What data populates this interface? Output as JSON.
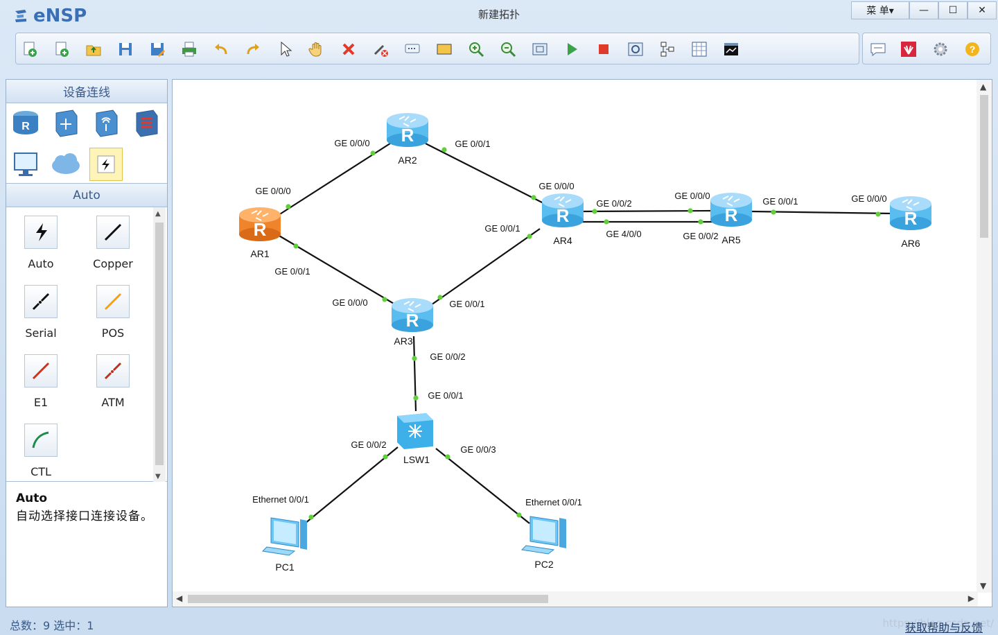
{
  "app": {
    "name": "eNSP",
    "title": "新建拓扑"
  },
  "window_controls": {
    "menu": "菜 单▾",
    "minimize": "—",
    "maximize": "☐",
    "close": "✕"
  },
  "toolbar": {
    "main": [
      "new-topology-icon",
      "new-example-icon",
      "open-icon",
      "save-icon",
      "save-as-icon",
      "print-icon",
      "undo-icon",
      "redo-icon",
      "select-icon",
      "pan-hand-icon",
      "delete-icon",
      "delete-link-icon",
      "text-label-icon",
      "rectangle-icon",
      "zoom-in-icon",
      "zoom-out-icon",
      "fit-view-icon",
      "start-devices-icon",
      "stop-devices-icon",
      "capture-icon",
      "topology-view-icon",
      "grid-icon",
      "console-icon"
    ],
    "right": [
      "chat-icon",
      "huawei-icon",
      "settings-icon",
      "help-icon"
    ]
  },
  "left_panel": {
    "header": "设备连线",
    "devices": [
      "router-icon",
      "switch-icon",
      "wireless-icon",
      "firewall-icon",
      "pc-icon",
      "cloud-icon",
      "connection-icon"
    ],
    "cable_header": "Auto",
    "cables": [
      {
        "label": "Auto",
        "icon": "auto-cable-icon",
        "color": "#111111"
      },
      {
        "label": "Copper",
        "icon": "copper-cable-icon",
        "color": "#111111"
      },
      {
        "label": "Serial",
        "icon": "serial-cable-icon",
        "color": "#111111"
      },
      {
        "label": "POS",
        "icon": "pos-cable-icon",
        "color": "#f5a01c"
      },
      {
        "label": "E1",
        "icon": "e1-cable-icon",
        "color": "#c8321e"
      },
      {
        "label": "ATM",
        "icon": "atm-cable-icon",
        "color": "#b8321e"
      },
      {
        "label": "CTL",
        "icon": "ctl-cable-icon",
        "color": "#1e8c4a"
      }
    ],
    "desc_title": "Auto",
    "desc_text": "自动选择接口连接设备。"
  },
  "topology": {
    "nodes": [
      {
        "id": "AR1",
        "label": "AR1",
        "type": "router",
        "color": "orange"
      },
      {
        "id": "AR2",
        "label": "AR2",
        "type": "router",
        "color": "blue"
      },
      {
        "id": "AR3",
        "label": "AR3",
        "type": "router",
        "color": "blue"
      },
      {
        "id": "AR4",
        "label": "AR4",
        "type": "router",
        "color": "blue"
      },
      {
        "id": "AR5",
        "label": "AR5",
        "type": "router",
        "color": "blue"
      },
      {
        "id": "AR6",
        "label": "AR6",
        "type": "router",
        "color": "blue"
      },
      {
        "id": "LSW1",
        "label": "LSW1",
        "type": "switch",
        "color": "blue"
      },
      {
        "id": "PC1",
        "label": "PC1",
        "type": "pc",
        "color": "blue"
      },
      {
        "id": "PC2",
        "label": "PC2",
        "type": "pc",
        "color": "blue"
      }
    ],
    "links": [
      {
        "a": "AR1",
        "b": "AR2",
        "a_port": "GE 0/0/0",
        "b_port": "GE 0/0/0"
      },
      {
        "a": "AR2",
        "b": "AR4",
        "a_port": "GE 0/0/1",
        "b_port": "GE 0/0/0"
      },
      {
        "a": "AR1",
        "b": "AR3",
        "a_port": "GE 0/0/1",
        "b_port": "GE 0/0/0"
      },
      {
        "a": "AR3",
        "b": "AR4",
        "a_port": "GE 0/0/1",
        "b_port": "GE 0/0/1"
      },
      {
        "a": "AR4",
        "b": "AR5",
        "a_port": "GE 0/0/2",
        "b_port": "GE 0/0/0"
      },
      {
        "a": "AR4",
        "b": "AR5",
        "a_port": "GE 4/0/0",
        "b_port": "GE 0/0/2"
      },
      {
        "a": "AR5",
        "b": "AR6",
        "a_port": "GE 0/0/1",
        "b_port": "GE 0/0/0"
      },
      {
        "a": "AR3",
        "b": "LSW1",
        "a_port": "GE 0/0/2",
        "b_port": "GE 0/0/1"
      },
      {
        "a": "LSW1",
        "b": "PC1",
        "a_port": "GE 0/0/2",
        "b_port": "Ethernet 0/0/1"
      },
      {
        "a": "LSW1",
        "b": "PC2",
        "a_port": "GE 0/0/3",
        "b_port": "Ethernet 0/0/1"
      }
    ]
  },
  "status": {
    "summary": "总数：9  选中：1",
    "help_link": "获取帮助与反馈",
    "watermark": "https://blog.csdn.net/"
  }
}
